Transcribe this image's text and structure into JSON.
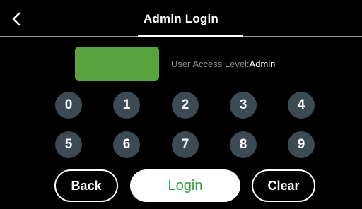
{
  "header": {
    "title": "Admin Login"
  },
  "status": {
    "access_label": "User Access Level:",
    "access_value": "Admin"
  },
  "keypad": {
    "row1": [
      "0",
      "1",
      "2",
      "3",
      "4"
    ],
    "row2": [
      "5",
      "6",
      "7",
      "8",
      "9"
    ]
  },
  "actions": {
    "back_label": "Back",
    "login_label": "Login",
    "clear_label": "Clear"
  },
  "colors": {
    "background": "#000000",
    "pin_display": "#58a43f",
    "key_fill": "#3c4a53",
    "login_text": "#2f9d3b",
    "muted_text": "#8d8d8d"
  },
  "icons": {
    "back": "chevron-left-icon"
  }
}
